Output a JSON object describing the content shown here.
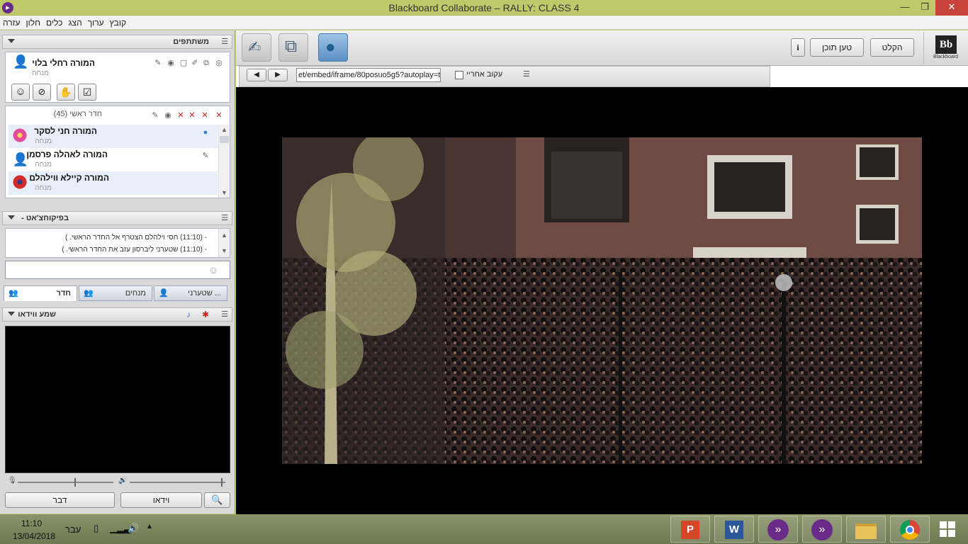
{
  "window": {
    "title": "Blackboard Collaborate – RALLY: CLASS 4",
    "app_icon": "collaborate-icon",
    "controls": {
      "minimize": "—",
      "maximize": "❐",
      "close": "✕"
    }
  },
  "menu": [
    "קובץ",
    "ערוך",
    "הצג",
    "כלים",
    "חלון",
    "עזרה"
  ],
  "participants_panel": {
    "title": "משתתפים",
    "me": {
      "name": "המורה רחלי בלוי",
      "role": "מנחה"
    },
    "room_label": "חדר ראשי",
    "room_count": "(45)",
    "list": [
      {
        "name": "המורה חני לסקר",
        "role": "מנחה",
        "avatar_color": "#e24c9a"
      },
      {
        "name": "המורה לאהלה פרסמן",
        "role": "מנחה",
        "avatar_color": "#888888"
      },
      {
        "name": "המורה קיילא ווילהלם",
        "role": "מנחה",
        "avatar_color": "#d42b2b"
      }
    ]
  },
  "chat_panel": {
    "title": "- בפיקוחצ'אט",
    "messages": [
      "- (11:10)  חסי וילהלם הצטרף אל החדר הראשי.  )",
      "- (11:10)  שטערני ליברסון עזב את החדר הראשי.  )"
    ],
    "tabs": [
      {
        "label": "חדר",
        "active": true
      },
      {
        "label": "מנחים",
        "active": false
      },
      {
        "label": "שטערני ...",
        "active": false
      }
    ]
  },
  "av_panel": {
    "title": "שמע ווידאו",
    "talk_label": "דבר",
    "video_label": "וידאו"
  },
  "toolbar": {
    "info_label": "i",
    "load_content_label": "טען תוכן",
    "record_label": "הקלט",
    "logo_text": "Bb",
    "logo_sub": "Blackboard"
  },
  "web_tour": {
    "url": "et/embed/iframe/80posuo5g5?autoplay=true",
    "follow_label": "עקוב אחריי"
  },
  "taskbar": {
    "time": "11:10",
    "date": "13/04/2018",
    "lang": "עבר"
  },
  "colors": {
    "titlebar": "#bfc96a",
    "close": "#c7423a",
    "accent": "#6a2a8a"
  }
}
